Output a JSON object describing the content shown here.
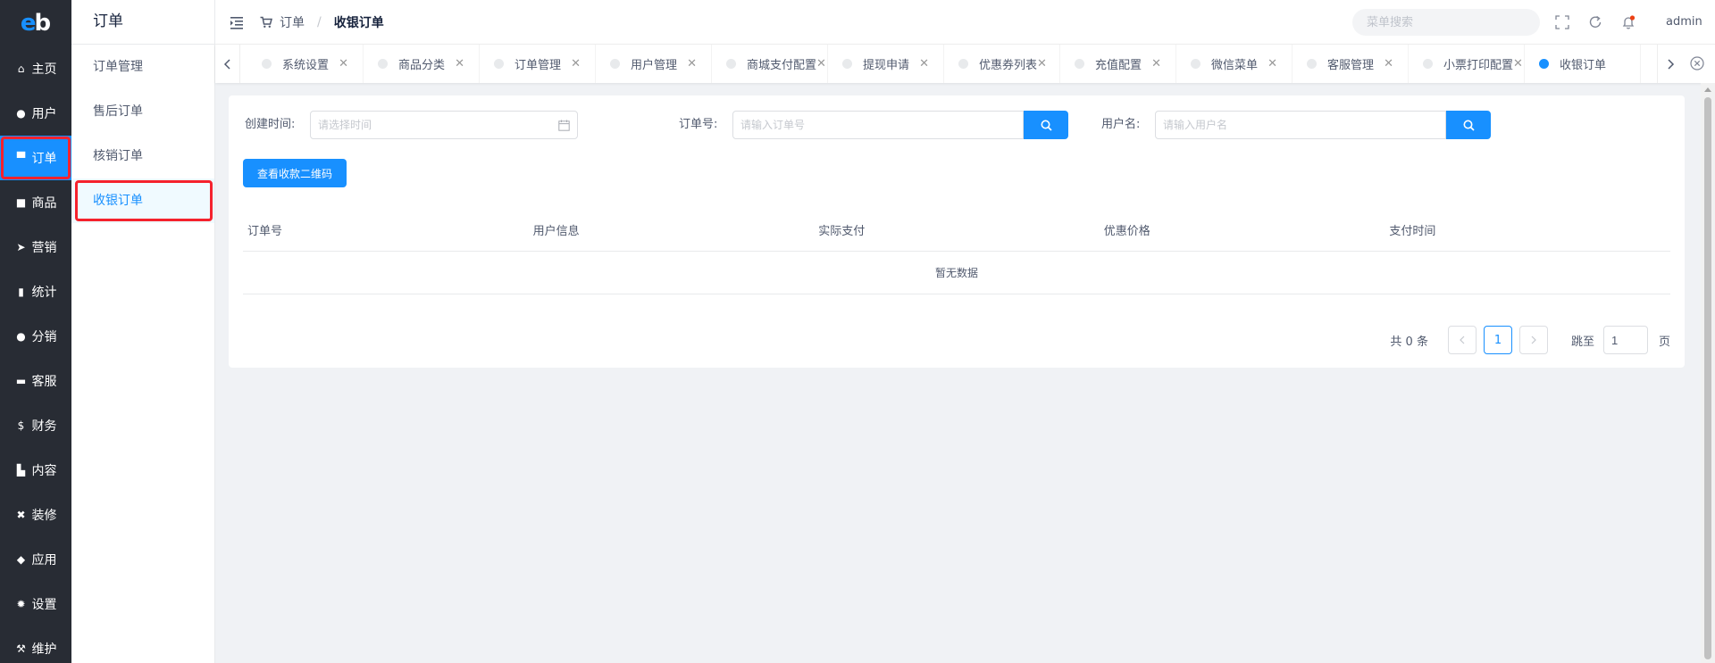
{
  "logo": {
    "e": "e",
    "b": "b"
  },
  "nav1": [
    {
      "label": "主页",
      "icon": "home-icon",
      "glyph": "⌂"
    },
    {
      "label": "用户",
      "icon": "user-icon",
      "glyph": "●"
    },
    {
      "label": "订单",
      "icon": "cart-icon",
      "glyph": "▀"
    },
    {
      "label": "商品",
      "icon": "basket-icon",
      "glyph": "■"
    },
    {
      "label": "营销",
      "icon": "send-icon",
      "glyph": "➤"
    },
    {
      "label": "统计",
      "icon": "bar-chart-icon",
      "glyph": "▮"
    },
    {
      "label": "分销",
      "icon": "group-icon",
      "glyph": "●"
    },
    {
      "label": "客服",
      "icon": "chat-icon",
      "glyph": "▬"
    },
    {
      "label": "财务",
      "icon": "dollar-icon",
      "glyph": "$"
    },
    {
      "label": "内容",
      "icon": "book-icon",
      "glyph": "▙"
    },
    {
      "label": "装修",
      "icon": "tools-icon",
      "glyph": "✖"
    },
    {
      "label": "应用",
      "icon": "cube-icon",
      "glyph": "◆"
    },
    {
      "label": "设置",
      "icon": "gear-icon",
      "glyph": "✹"
    },
    {
      "label": "维护",
      "icon": "hammer-icon",
      "glyph": "⚒"
    }
  ],
  "nav2": {
    "title": "订单",
    "items": [
      {
        "label": "订单管理"
      },
      {
        "label": "售后订单"
      },
      {
        "label": "核销订单"
      },
      {
        "label": "收银订单"
      }
    ]
  },
  "header": {
    "breadcrumb": {
      "parent": "订单",
      "sep": "/",
      "current": "收银订单"
    },
    "search_placeholder": "菜单搜索",
    "user": "admin"
  },
  "tabs": [
    {
      "label": "系统设置"
    },
    {
      "label": "商品分类"
    },
    {
      "label": "订单管理"
    },
    {
      "label": "用户管理"
    },
    {
      "label": "商城支付配置"
    },
    {
      "label": "提现申请"
    },
    {
      "label": "优惠券列表"
    },
    {
      "label": "充值配置"
    },
    {
      "label": "微信菜单"
    },
    {
      "label": "客服管理"
    },
    {
      "label": "小票打印配置"
    },
    {
      "label": "收银订单"
    }
  ],
  "filters": {
    "time_label": "创建时间:",
    "time_placeholder": "请选择时间",
    "order_label": "订单号:",
    "order_placeholder": "请输入订单号",
    "user_label": "用户名:",
    "user_placeholder": "请输入用户名"
  },
  "qr_button": "查看收款二维码",
  "table": {
    "headers": [
      "订单号",
      "用户信息",
      "实际支付",
      "优惠价格",
      "支付时间"
    ],
    "empty": "暂无数据"
  },
  "pager": {
    "total": "共 0 条",
    "current": "1",
    "jump_label": "跳至",
    "jump_value": "1",
    "page_suffix": "页"
  },
  "colors": {
    "primary": "#1890ff",
    "sidebar": "#282c34",
    "highlight": "#f5222d"
  }
}
